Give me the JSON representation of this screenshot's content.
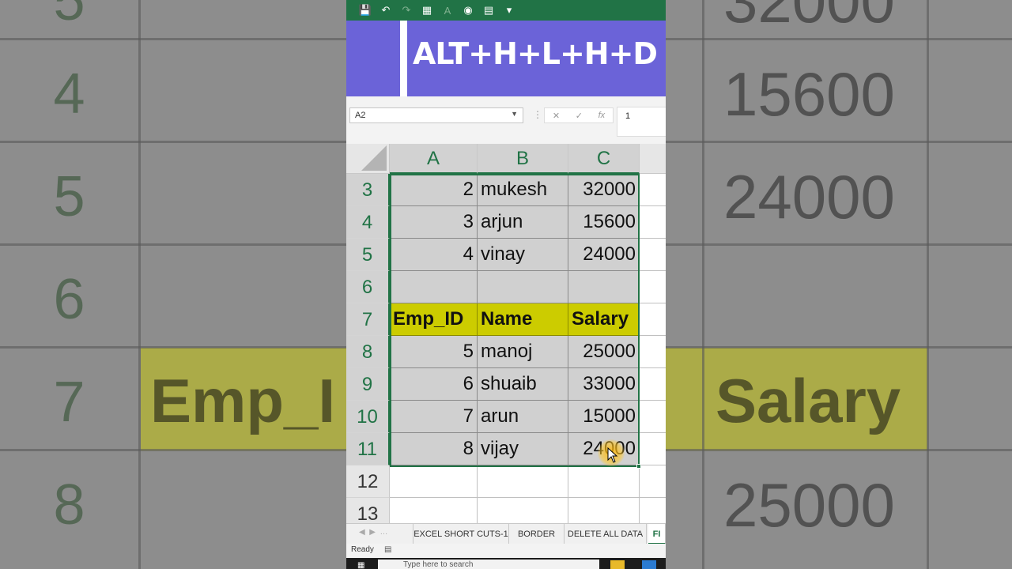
{
  "app": {
    "banner_text": "ALT+H+L+H+D",
    "accent_color": "#217346",
    "banner_color": "#6b63d8",
    "header_fill_color": "#cccc00"
  },
  "toolbar": {
    "icons": [
      "save-icon",
      "undo-icon",
      "redo-icon",
      "borders-icon",
      "font-color-icon",
      "camera-icon",
      "form-icon",
      "customize-icon"
    ]
  },
  "formula_bar": {
    "name_box": "A2",
    "formula_value": "1",
    "cancel_symbol": "✕",
    "enter_symbol": "✓",
    "fx_symbol": "fx"
  },
  "columns": [
    "A",
    "B",
    "C"
  ],
  "rows": [
    {
      "num": "3",
      "a": "2",
      "b": "mukesh",
      "c": "32000",
      "type": "data"
    },
    {
      "num": "4",
      "a": "3",
      "b": "arjun",
      "c": "15600",
      "type": "data"
    },
    {
      "num": "5",
      "a": "4",
      "b": "vinay",
      "c": "24000",
      "type": "data"
    },
    {
      "num": "6",
      "a": "",
      "b": "",
      "c": "",
      "type": "empty"
    },
    {
      "num": "7",
      "a": "Emp_ID",
      "b": "Name",
      "c": "Salary",
      "type": "header"
    },
    {
      "num": "8",
      "a": "5",
      "b": "manoj",
      "c": "25000",
      "type": "data"
    },
    {
      "num": "9",
      "a": "6",
      "b": "shuaib",
      "c": "33000",
      "type": "data"
    },
    {
      "num": "10",
      "a": "7",
      "b": "arun",
      "c": "15000",
      "type": "data"
    },
    {
      "num": "11",
      "a": "8",
      "b": "vijay",
      "c": "24000",
      "type": "data"
    },
    {
      "num": "12",
      "a": "",
      "b": "",
      "c": "",
      "type": "blank"
    },
    {
      "num": "13",
      "a": "",
      "b": "",
      "c": "",
      "type": "blank"
    }
  ],
  "sheet_tabs": [
    "EXCEL SHORT CUTS-1",
    "BORDER",
    "DELETE ALL DATA",
    "FI"
  ],
  "status": {
    "ready": "Ready"
  },
  "taskbar": {
    "search_placeholder": "Type here to search"
  },
  "background": {
    "row_nums": [
      "5",
      "4",
      "5",
      "6",
      "7",
      "8"
    ],
    "cells": [
      "32000",
      "15600",
      "24000",
      "Emp_I",
      "Salary",
      "25000"
    ]
  }
}
